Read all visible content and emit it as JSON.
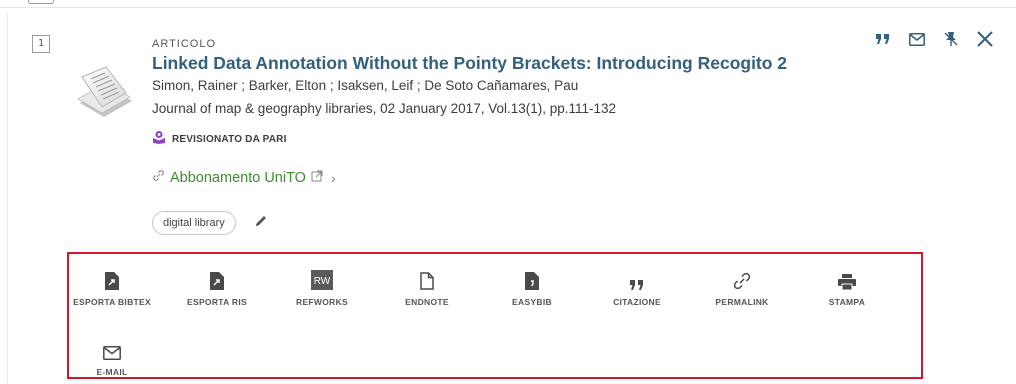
{
  "record": {
    "index": "1",
    "type": "ARTICOLO",
    "title": "Linked Data Annotation Without the Pointy Brackets: Introducing Recogito 2",
    "authors": "Simon, Rainer ; Barker, Elton ; Isaksen, Leif ; De Soto Cañamares, Pau",
    "source": "Journal of map & geography libraries, 02 January 2017, Vol.13(1), pp.111-132",
    "peer_reviewed": "REVISIONATO DA PARI",
    "access_link": "Abbonamento UniTO",
    "tag": "digital library"
  },
  "top_actions": [
    "quote-icon",
    "mail-icon",
    "pin-icon",
    "close-icon"
  ],
  "actions": [
    {
      "label": "ESPORTA BIBTEX",
      "icon": "export-bibtex-icon"
    },
    {
      "label": "ESPORTA RIS",
      "icon": "export-ris-icon"
    },
    {
      "label": "REFWORKS",
      "icon": "refworks-icon"
    },
    {
      "label": "ENDNOTE",
      "icon": "endnote-icon"
    },
    {
      "label": "EASYBIB",
      "icon": "easybib-icon"
    },
    {
      "label": "CITAZIONE",
      "icon": "quote-icon"
    },
    {
      "label": "PERMALINK",
      "icon": "link-icon"
    },
    {
      "label": "STAMPA",
      "icon": "print-icon"
    },
    {
      "label": "E-MAIL",
      "icon": "mail-icon"
    }
  ],
  "colors": {
    "title": "#33607f",
    "access_link": "#3f8c2f",
    "actions_border": "#d0182b",
    "peer_badge": "#8e44c9"
  }
}
